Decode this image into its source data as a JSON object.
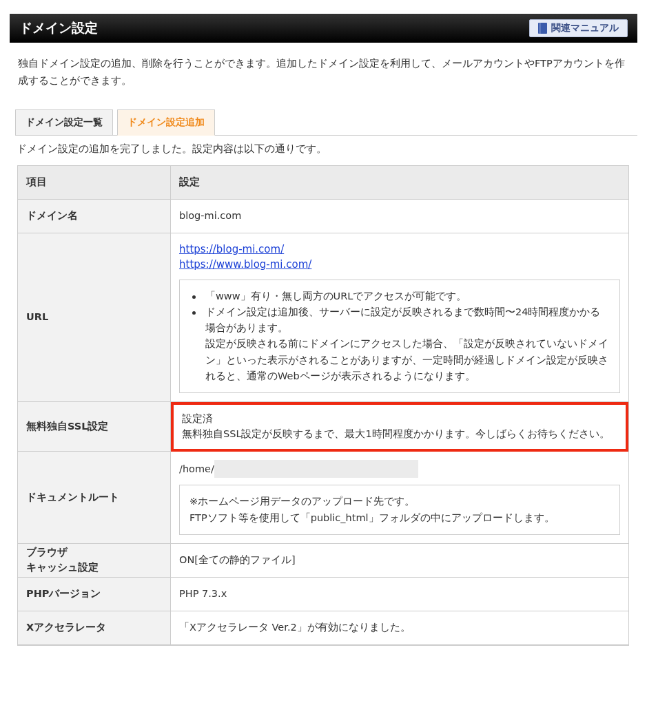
{
  "header": {
    "title": "ドメイン設定",
    "manual_button": "関連マニュアル"
  },
  "description": "独自ドメイン設定の追加、削除を行うことができます。追加したドメイン設定を利用して、メールアカウントやFTPアカウントを作成することができます。",
  "tabs": [
    {
      "label": "ドメイン設定一覧",
      "selected": false
    },
    {
      "label": "ドメイン設定追加",
      "selected": true
    }
  ],
  "message": "ドメイン設定の追加を完了しました。設定内容は以下の通りです。",
  "table": {
    "columns": [
      "項目",
      "設定"
    ],
    "rows": [
      {
        "label": [
          "ドメイン名"
        ],
        "kind": "text",
        "value": "blog-mi.com",
        "highlighted": false
      },
      {
        "label": [
          "URL"
        ],
        "kind": "links",
        "links": [
          "https://blog-mi.com/",
          "https://www.blog-mi.com/"
        ],
        "notes": [
          [
            "「www」有り・無し両方のURLでアクセスが可能です。"
          ],
          [
            "ドメイン設定は追加後、サーバーに設定が反映されるまで数時間〜24時間程度かかる場合があります。",
            "設定が反映される前にドメインにアクセスした場合、「設定が反映されていないドメイン」といった表示がされることがありますが、一定時間が経過しドメイン設定が反映されると、通常のWebページが表示されるようになります。"
          ]
        ],
        "highlighted": false
      },
      {
        "label": [
          "無料独自SSL設定"
        ],
        "kind": "lines",
        "lines": [
          "設定済",
          "無料独自SSL設定が反映するまで、最大1時間程度かかります。今しばらくお待ちください。"
        ],
        "highlighted": true
      },
      {
        "label": [
          "ドキュメントルート"
        ],
        "kind": "path",
        "value": "/home/",
        "note": [
          "※ホームページ用データのアップロード先です。",
          "FTPソフト等を使用して「public_html」フォルダの中にアップロードします。"
        ],
        "highlighted": false
      },
      {
        "label": [
          "ブラウザ",
          "キャッシュ設定"
        ],
        "kind": "text",
        "value": "ON[全ての静的ファイル]",
        "highlighted": false
      },
      {
        "label": [
          "PHPバージョン"
        ],
        "kind": "text",
        "value": "PHP 7.3.x",
        "highlighted": false
      },
      {
        "label": [
          "Xアクセラレータ"
        ],
        "kind": "text",
        "value": "「Xアクセラレータ Ver.2」が有効になりました。",
        "highlighted": false
      }
    ]
  }
}
